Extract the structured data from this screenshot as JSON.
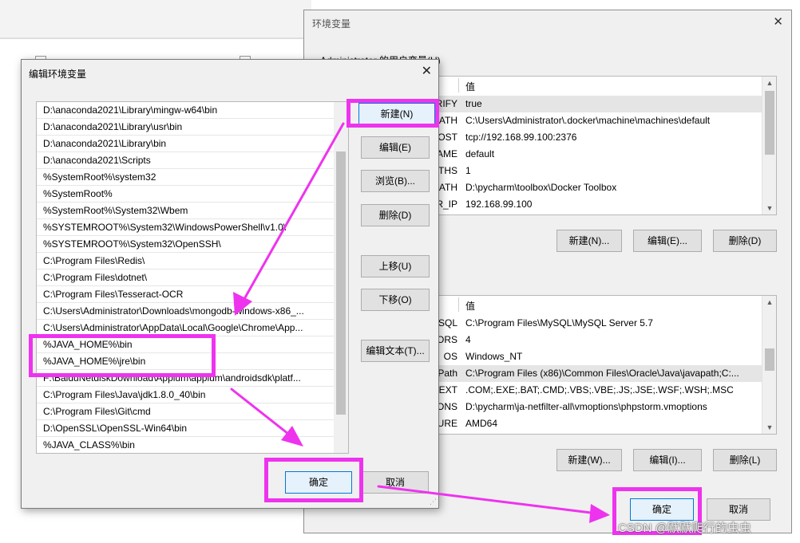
{
  "env_window": {
    "title": "环境变量",
    "close_glyph": "✕",
    "user_group_label": "Administrator 的用户变量(U)",
    "system_group_label": "",
    "col_value": "值",
    "user_vars": [
      {
        "name": "DOCKER_TLS_VERIFY",
        "value": "true",
        "selected": true
      },
      {
        "name": "DOCKER_CERT_PATH",
        "value": "C:\\Users\\Administrator\\.docker\\machine\\machines\\default",
        "selected": false
      },
      {
        "name": "DOCKER_HOST",
        "value": "tcp://192.168.99.100:2376",
        "selected": false
      },
      {
        "name": "DOCKER_MACHINE_NAME",
        "value": "default",
        "selected": false
      },
      {
        "name": "COMPOSE_CONVERT_WINDOWS_PATHS",
        "value": "1",
        "selected": false
      },
      {
        "name": "DOCKER_TOOLBOX_INSTALL_PATH",
        "value": "D:\\pycharm\\toolbox\\Docker Toolbox",
        "selected": false
      },
      {
        "name": "DOCKER_IP",
        "value": "192.168.99.100",
        "selected": false
      }
    ],
    "sys_vars": [
      {
        "name": "MySQL",
        "value": "C:\\Program Files\\MySQL\\MySQL Server 5.7",
        "selected": false
      },
      {
        "name": "NUMBER_OF_PROCESSORS",
        "value": "4",
        "selected": false
      },
      {
        "name": "OS",
        "value": "Windows_NT",
        "selected": false
      },
      {
        "name": "Path",
        "value": "C:\\Program Files (x86)\\Common Files\\Oracle\\Java\\javapath;C:...",
        "selected": true
      },
      {
        "name": "PATHEXT",
        "value": ".COM;.EXE;.BAT;.CMD;.VBS;.VBE;.JS;.JSE;.WSF;.WSH;.MSC",
        "selected": false
      },
      {
        "name": "PHPSTORM_VM_OPTIONS",
        "value": "D:\\pycharm\\ja-netfilter-all\\vmoptions\\phpstorm.vmoptions",
        "selected": false
      },
      {
        "name": "PROCESSOR_ARCHITECTURE",
        "value": "AMD64",
        "selected": false
      }
    ],
    "user_buttons": {
      "new": "新建(N)...",
      "edit": "编辑(E)...",
      "delete": "删除(D)"
    },
    "sys_buttons": {
      "new": "新建(W)...",
      "edit": "编辑(I)...",
      "delete": "删除(L)"
    },
    "ok": "确定",
    "cancel": "取消"
  },
  "edit_dialog": {
    "title": "编辑环境变量",
    "close_glyph": "✕",
    "paths": [
      "D:\\anaconda2021\\Library\\mingw-w64\\bin",
      "D:\\anaconda2021\\Library\\usr\\bin",
      "D:\\anaconda2021\\Library\\bin",
      "D:\\anaconda2021\\Scripts",
      "%SystemRoot%\\system32",
      "%SystemRoot%",
      "%SystemRoot%\\System32\\Wbem",
      "%SYSTEMROOT%\\System32\\WindowsPowerShell\\v1.0\\",
      "%SYSTEMROOT%\\System32\\OpenSSH\\",
      "C:\\Program Files\\Redis\\",
      "C:\\Program Files\\dotnet\\",
      "C:\\Program Files\\Tesseract-OCR",
      "C:\\Users\\Administrator\\Downloads\\mongodb-windows-x86_...",
      "C:\\Users\\Administrator\\AppData\\Local\\Google\\Chrome\\App...",
      "%JAVA_HOME%\\bin",
      "%JAVA_HOME%\\jre\\bin",
      "F:\\BaiduNetdiskDownload\\Appium\\appium\\androidsdk\\platf...",
      "C:\\Program Files\\Java\\jdk1.8.0_40\\bin",
      "C:\\Program Files\\Git\\cmd",
      "D:\\OpenSSL\\OpenSSL-Win64\\bin",
      "%JAVA_CLASS%\\bin"
    ],
    "buttons": {
      "new": "新建(N)",
      "edit": "编辑(E)",
      "browse": "浏览(B)...",
      "delete": "删除(D)",
      "move_up": "上移(U)",
      "move_down": "下移(O)",
      "edit_text": "编辑文本(T)..."
    },
    "ok": "确定",
    "cancel": "取消"
  },
  "annotation_color": "#ee33ee",
  "watermark": "CSDN @默默爬行的虫虫"
}
